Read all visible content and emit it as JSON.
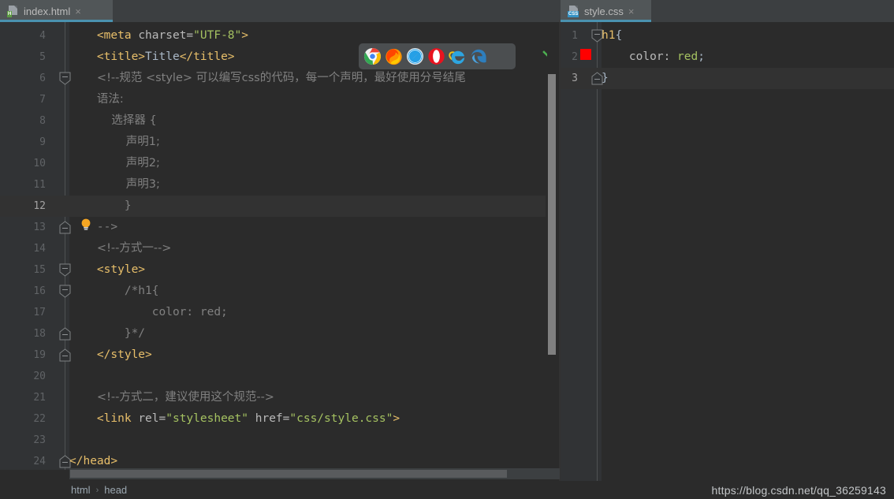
{
  "window": {
    "theme": "darcula",
    "colors": {
      "editor_bg": "#2b2b2b",
      "gutter_bg": "#313335",
      "tab_active_bg": "#515658",
      "tab_underline": "#4a92b0",
      "tag": "#e8bf6a",
      "string": "#a5c261",
      "comment": "#808080",
      "text": "#a9b7c6",
      "current_line": "#323232",
      "color_swatch_red": "#ff0000",
      "checkmark_green": "#4caf50"
    }
  },
  "tabs": [
    {
      "label": "index.html",
      "icon": "html-file-icon",
      "badge": "H",
      "active": true,
      "close": "×"
    },
    {
      "label": "style.css",
      "icon": "css-file-icon",
      "badge": "CSS",
      "active": true,
      "close": "×"
    }
  ],
  "left_editor": {
    "file": "index.html",
    "first_line": 4,
    "current_line": 12,
    "line_numbers": [
      4,
      5,
      6,
      7,
      8,
      9,
      10,
      11,
      12,
      13,
      14,
      15,
      16,
      17,
      18,
      19,
      20,
      21,
      22,
      23,
      24
    ],
    "lines": [
      {
        "n": 4,
        "indent": 4,
        "tokens": [
          {
            "t": "tag",
            "v": "<meta "
          },
          {
            "t": "attr",
            "v": "charset="
          },
          {
            "t": "string",
            "v": "\"UTF-8\""
          },
          {
            "t": "tag",
            "v": ">"
          }
        ]
      },
      {
        "n": 5,
        "indent": 4,
        "tokens": [
          {
            "t": "tag",
            "v": "<title>"
          },
          {
            "t": "text",
            "v": "Title"
          },
          {
            "t": "tag",
            "v": "</title>"
          }
        ]
      },
      {
        "n": 6,
        "indent": 4,
        "fold": "down",
        "tokens": [
          {
            "t": "comment",
            "v": "<!--规范 <style> 可以编写css的代码，每一个声明，最好使用分号结尾"
          }
        ]
      },
      {
        "n": 7,
        "indent": 4,
        "tokens": [
          {
            "t": "comment",
            "v": "语法:"
          }
        ]
      },
      {
        "n": 8,
        "indent": 4,
        "tokens": [
          {
            "t": "comment",
            "v": "    选择器 {"
          }
        ]
      },
      {
        "n": 9,
        "indent": 4,
        "tokens": [
          {
            "t": "comment",
            "v": "        声明1;"
          }
        ]
      },
      {
        "n": 10,
        "indent": 4,
        "tokens": [
          {
            "t": "comment",
            "v": "        声明2;"
          }
        ]
      },
      {
        "n": 11,
        "indent": 4,
        "tokens": [
          {
            "t": "comment",
            "v": "        声明3;"
          }
        ]
      },
      {
        "n": 12,
        "indent": 4,
        "bulb": true,
        "tokens": [
          {
            "t": "comment",
            "v": "    }"
          }
        ]
      },
      {
        "n": 13,
        "indent": 4,
        "fold": "up",
        "tokens": [
          {
            "t": "comment",
            "v": "-->"
          }
        ]
      },
      {
        "n": 14,
        "indent": 4,
        "tokens": [
          {
            "t": "comment",
            "v": "<!--方式一-->"
          }
        ]
      },
      {
        "n": 15,
        "indent": 4,
        "fold": "down",
        "tokens": [
          {
            "t": "tag",
            "v": "<style>"
          }
        ]
      },
      {
        "n": 16,
        "indent": 4,
        "fold": "down",
        "tokens": [
          {
            "t": "comment",
            "v": "    /*h1{"
          }
        ]
      },
      {
        "n": 17,
        "indent": 4,
        "tokens": [
          {
            "t": "comment",
            "v": "        color: red;"
          }
        ]
      },
      {
        "n": 18,
        "indent": 4,
        "fold": "up",
        "tokens": [
          {
            "t": "comment",
            "v": "    }*/"
          }
        ]
      },
      {
        "n": 19,
        "indent": 4,
        "fold": "up",
        "tokens": [
          {
            "t": "tag",
            "v": "</style>"
          }
        ]
      },
      {
        "n": 20,
        "indent": 4,
        "tokens": []
      },
      {
        "n": 21,
        "indent": 4,
        "tokens": [
          {
            "t": "comment",
            "v": "<!--方式二，建议使用这个规范-->"
          }
        ]
      },
      {
        "n": 22,
        "indent": 4,
        "tokens": [
          {
            "t": "tag",
            "v": "<link "
          },
          {
            "t": "attr",
            "v": "rel="
          },
          {
            "t": "string",
            "v": "\"stylesheet\""
          },
          {
            "t": "attr",
            "v": " href="
          },
          {
            "t": "string",
            "v": "\"css/style.css\""
          },
          {
            "t": "tag",
            "v": ">"
          }
        ]
      },
      {
        "n": 23,
        "indent": 4,
        "tokens": []
      },
      {
        "n": 24,
        "indent": 0,
        "fold": "up",
        "tokens": [
          {
            "t": "tag",
            "v": "</head>"
          }
        ]
      }
    ],
    "inspection_status": "ok-checkmark"
  },
  "right_editor": {
    "file": "style.css",
    "first_line": 1,
    "current_line": 3,
    "line_numbers": [
      1,
      2,
      3
    ],
    "lines": [
      {
        "n": 1,
        "fold": "down",
        "tokens": [
          {
            "t": "sel",
            "v": "h1"
          },
          {
            "t": "punc",
            "v": "{"
          }
        ]
      },
      {
        "n": 2,
        "swatch": "#ff0000",
        "tokens": [
          {
            "t": "prop",
            "v": "    color: "
          },
          {
            "t": "val",
            "v": "red"
          },
          {
            "t": "punc",
            "v": ";"
          }
        ]
      },
      {
        "n": 3,
        "fold": "up",
        "tokens": [
          {
            "t": "punc",
            "v": "}"
          }
        ]
      }
    ]
  },
  "browser_popup": {
    "name": "open-in-browser-toolbar",
    "browsers": [
      {
        "name": "chrome-icon",
        "label": "Chrome"
      },
      {
        "name": "firefox-icon",
        "label": "Firefox"
      },
      {
        "name": "safari-icon",
        "label": "Safari"
      },
      {
        "name": "opera-icon",
        "label": "Opera"
      },
      {
        "name": "ie-icon",
        "label": "Internet Explorer"
      },
      {
        "name": "edge-icon",
        "label": "Edge"
      }
    ]
  },
  "breadcrumb": {
    "items": [
      "html",
      "head"
    ],
    "separator": "›"
  },
  "watermark": {
    "text": "https://blog.csdn.net/qq_36259143"
  }
}
